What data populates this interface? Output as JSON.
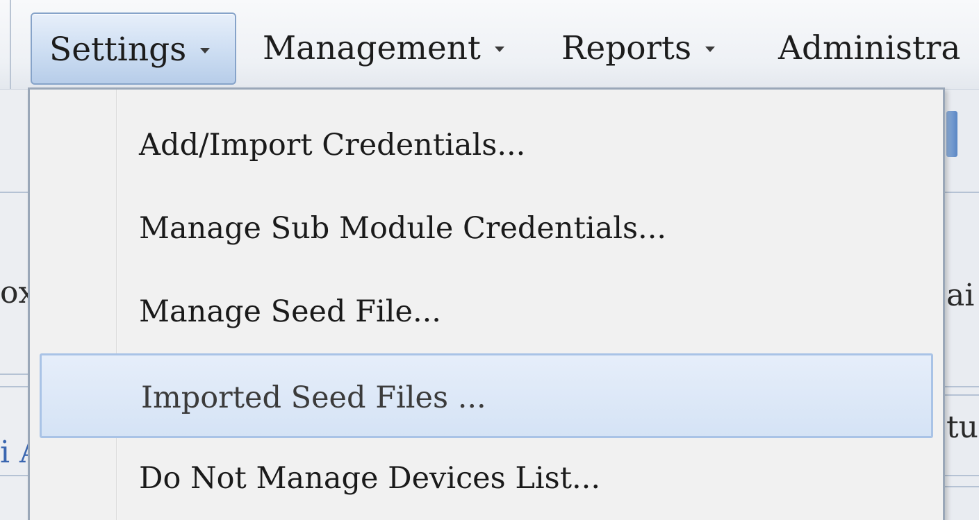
{
  "menubar": {
    "items": [
      {
        "label": "Settings",
        "active": true
      },
      {
        "label": "Management",
        "active": false
      },
      {
        "label": "Reports",
        "active": false
      },
      {
        "label": "Administra",
        "active": false
      }
    ]
  },
  "dropdown": {
    "items": [
      {
        "label": "Add/Import Credentials..."
      },
      {
        "label": "Manage Sub Module Credentials..."
      },
      {
        "label": "Manage Seed File..."
      },
      {
        "label": "Imported Seed Files ...",
        "hovered": true
      },
      {
        "label": "Do Not Manage Devices List..."
      }
    ]
  },
  "background": {
    "left_fragment_1": "ox",
    "left_fragment_2": "i A",
    "right_fragment_1": "ai",
    "right_fragment_2": "tu"
  },
  "colors": {
    "highlight_fill": "#d5e3f5",
    "highlight_border": "#a9c3e6",
    "active_menu_fill": "#cfdff3",
    "menu_background": "#f1f1f1"
  }
}
